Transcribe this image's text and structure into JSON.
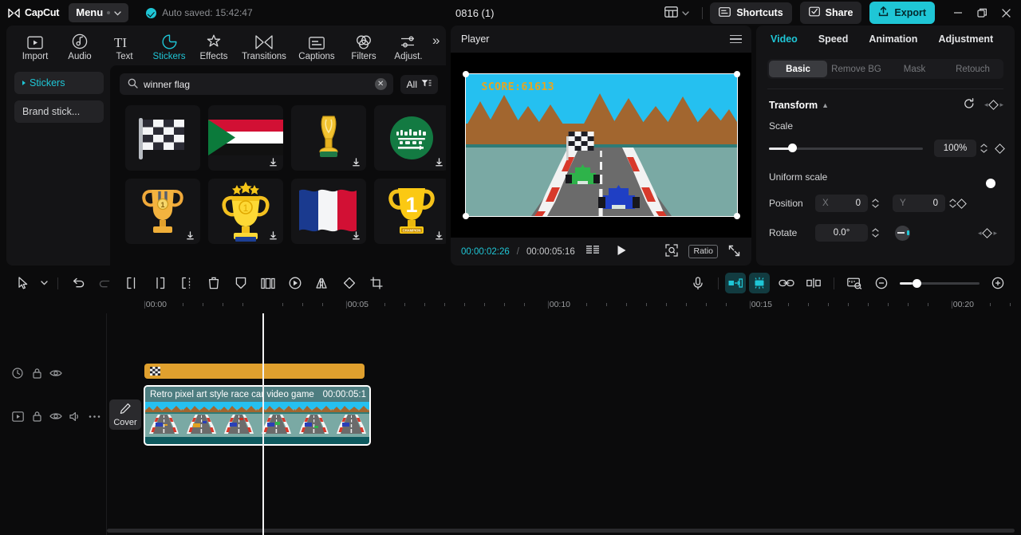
{
  "app": {
    "name": "CapCut",
    "project_title": "0816 (1)"
  },
  "titlebar": {
    "menu_label": "Menu",
    "autosave_text": "Auto saved: 15:42:47",
    "shortcuts_label": "Shortcuts",
    "share_label": "Share",
    "export_label": "Export"
  },
  "tool_tabs": [
    {
      "label": "Import",
      "icon": "import-icon",
      "active": false
    },
    {
      "label": "Audio",
      "icon": "audio-icon",
      "active": false
    },
    {
      "label": "Text",
      "icon": "text-icon",
      "active": false
    },
    {
      "label": "Stickers",
      "icon": "stickers-icon",
      "active": true
    },
    {
      "label": "Effects",
      "icon": "effects-icon",
      "active": false
    },
    {
      "label": "Transitions",
      "icon": "transitions-icon",
      "active": false
    },
    {
      "label": "Captions",
      "icon": "captions-icon",
      "active": false
    },
    {
      "label": "Filters",
      "icon": "filters-icon",
      "active": false
    },
    {
      "label": "Adjust.",
      "icon": "adjust-icon",
      "active": false
    }
  ],
  "left_sidebar": {
    "items": [
      {
        "label": "Stickers",
        "active": true
      },
      {
        "label": "Brand stick...",
        "active": false
      }
    ]
  },
  "search": {
    "value": "winner flag",
    "placeholder": "Search",
    "filter_label": "All"
  },
  "sticker_grid": [
    {
      "name": "chequered-flag",
      "downloadable": false
    },
    {
      "name": "flag-sudan",
      "downloadable": true
    },
    {
      "name": "world-cup-trophy",
      "downloadable": true
    },
    {
      "name": "flag-saudi-arabia",
      "downloadable": true
    },
    {
      "name": "trophy-medal",
      "downloadable": true
    },
    {
      "name": "trophy-stars-number-one",
      "downloadable": true
    },
    {
      "name": "flag-france",
      "downloadable": true
    },
    {
      "name": "trophy-champion-one",
      "downloadable": true
    }
  ],
  "player": {
    "title": "Player",
    "current_time": "00:00:02:26",
    "separator": "/",
    "total_time": "00:00:05:16",
    "ratio_label": "Ratio",
    "score_overlay": "SCORE:61613"
  },
  "right_panel": {
    "tabs": [
      {
        "label": "Video",
        "active": true
      },
      {
        "label": "Speed",
        "active": false
      },
      {
        "label": "Animation",
        "active": false
      },
      {
        "label": "Adjustment",
        "active": false
      }
    ],
    "segments": [
      {
        "label": "Basic",
        "active": true
      },
      {
        "label": "Remove BG",
        "active": false
      },
      {
        "label": "Mask",
        "active": false
      },
      {
        "label": "Retouch",
        "active": false
      }
    ],
    "transform": {
      "title": "Transform",
      "scale_label": "Scale",
      "scale_value": "100%",
      "scale_percent": 15,
      "uniform_scale_label": "Uniform scale",
      "uniform_scale_on": true,
      "position_label": "Position",
      "position_x_axis": "X",
      "position_x": "0",
      "position_y_axis": "Y",
      "position_y": "0",
      "rotate_label": "Rotate",
      "rotate_value": "0.0°"
    }
  },
  "timeline": {
    "ruler_labels": [
      "00:00",
      "00:05",
      "00:10",
      "00:15",
      "00:20"
    ],
    "playhead_time": "00:00:02:26",
    "cover_label": "Cover",
    "clips": {
      "sticker_track": {
        "name": "chequered-flag-sticker"
      },
      "video_track": {
        "name": "Retro pixel art style race car video game",
        "duration": "00:00:05:1"
      }
    }
  }
}
